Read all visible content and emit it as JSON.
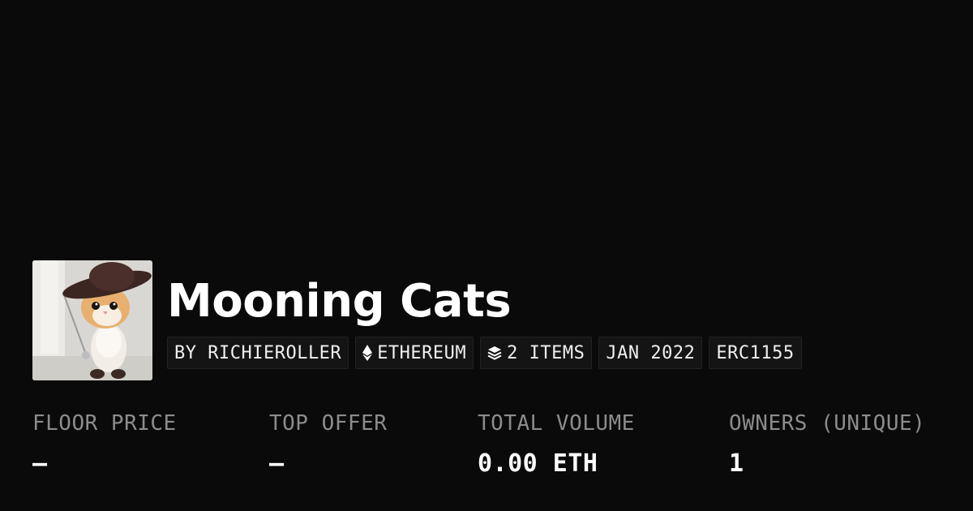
{
  "collection": {
    "title": "Mooning Cats",
    "avatar_alt": "cat-in-hat-avatar"
  },
  "badges": [
    {
      "label": "BY RICHIEROLLER",
      "icon": null
    },
    {
      "label": "ETHEREUM",
      "icon": "ethereum-icon"
    },
    {
      "label": "2 ITEMS",
      "icon": "layers-icon"
    },
    {
      "label": "JAN 2022",
      "icon": null
    },
    {
      "label": "ERC1155",
      "icon": null
    }
  ],
  "stats": [
    {
      "label": "FLOOR PRICE",
      "value": "—"
    },
    {
      "label": "TOP OFFER",
      "value": "—"
    },
    {
      "label": "TOTAL VOLUME",
      "value": "0.00 ETH"
    },
    {
      "label": "OWNERS (UNIQUE)",
      "value": "1"
    }
  ]
}
